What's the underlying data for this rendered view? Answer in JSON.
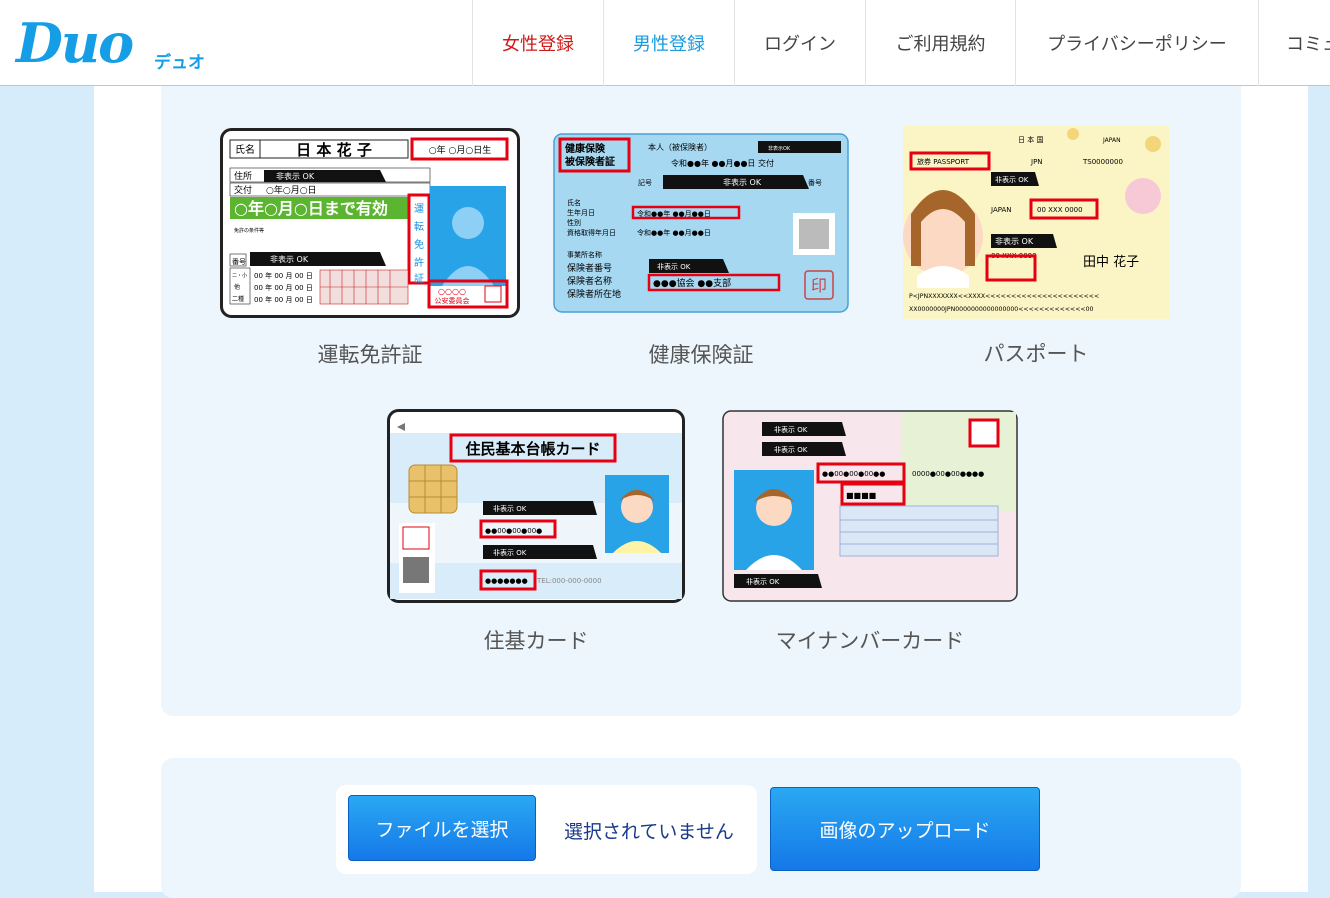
{
  "header": {
    "logo_text": "Duo",
    "logo_sub": "デュオ",
    "nav": [
      "女性登録",
      "男性登録",
      "ログイン",
      "ご利用規約",
      "プライバシーポリシー",
      "コミュ"
    ]
  },
  "cards": [
    {
      "label": "運転免許証",
      "fields": {
        "name_label": "氏名",
        "name_value": "日 本 花 子",
        "dob": "○年 ○月○日生",
        "address_label": "住所",
        "issue_label": "交付",
        "issue_value": "○年○月○日",
        "hide_ok_1": "非表示 OK",
        "validity": "○年○月○日まで有効",
        "conditions_label": "免許の条件等",
        "number_label": "番号",
        "hide_ok_2": "非表示 OK",
        "dates": [
          "00 年 00 月 00 日",
          "00 年 00 月 00 日",
          "00 年 00 月 00 日"
        ],
        "side_labels": [
          "二・小",
          "他",
          "二種"
        ],
        "vertical_title": "運転免許証",
        "issuer_code": "○○○○",
        "issuer": "公安委員会"
      }
    },
    {
      "label": "健康保険証",
      "fields": {
        "title_1": "健康保険",
        "title_2": "被保険者証",
        "holder": "本人（被保険者）",
        "hide_ok_top": "非表示OK",
        "issue": "令和●●年 ●●月●●日 交付",
        "symbol_label": "記号",
        "hide_ok_1": "非表示 OK",
        "number_label": "番号",
        "name_label": "氏名",
        "dob_label": "生年月日",
        "dob_value": "令和●●年 ●●月●●日",
        "sex_label": "性別",
        "qualification_label": "資格取得年月日",
        "qualification_value": "令和●●年 ●●月●●日",
        "employer_label": "事業所名称",
        "insurer_number_label": "保険者番号",
        "hide_ok_2": "非表示 OK",
        "insurer_name_label": "保険者名称",
        "insurer_name_value": "●●●協会 ●●支部",
        "insurer_address_label": "保険者所在地",
        "seal": "印"
      }
    },
    {
      "label": "パスポート",
      "fields": {
        "country": "日 本 国",
        "country_en": "JAPAN",
        "type": "旅券 PASSPORT",
        "code": "JPN",
        "passport_no": "TS0000000",
        "hide_ok_1": "非表示 OK",
        "nationality": "JAPAN",
        "number": "00 XXX 0000",
        "hide_ok_2": "非表示 OK",
        "date": "00 XXX 0000",
        "signature": "田中 花子",
        "mrz_1": "P<JPNXXXXXXX<<XXXX<<<<<<<<<<<<<<<<<<<<<<",
        "mrz_2": "XX0000000JPN0000000000000000<<<<<<<<<<<<<00"
      }
    },
    {
      "label": "住基カード",
      "fields": {
        "title": "住民基本台帳カード",
        "hide_ok_1": "非表示 OK",
        "number": "●●00●00●00●",
        "hide_ok_2": "非表示 OK",
        "code": "●●●●●●●",
        "tel": "TEL:000-000-0000"
      }
    },
    {
      "label": "マイナンバーカード",
      "fields": {
        "hide_ok_1": "非表示 OK",
        "hide_ok_2": "非表示 OK",
        "number": "●●00●00●00●●",
        "number_right": "0000●00●00●●●●",
        "code": "■■■■",
        "hide_ok_3": "非表示 OK"
      }
    }
  ],
  "upload": {
    "choose_file": "ファイルを選択",
    "no_file": "選択されていません",
    "upload_button": "画像のアップロード"
  },
  "colors": {
    "brand": "#159ee6",
    "female": "#d01a1a",
    "male": "#1a9be0",
    "highlight": "#e60012"
  }
}
